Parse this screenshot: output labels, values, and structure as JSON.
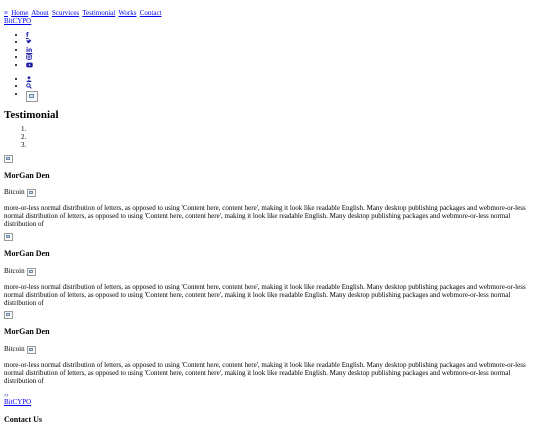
{
  "header": {
    "toggle": "≡",
    "nav": [
      "Home",
      "About",
      "Scurvices",
      "Testimonial",
      "Works",
      "Contact"
    ],
    "brand": "BitCYPO"
  },
  "social": [
    "facebook-icon",
    "twitter-icon",
    "linkedin-icon",
    "instagram-icon",
    "youtube-icon"
  ],
  "user_tools": [
    "user-icon",
    "search-icon",
    "flag-image"
  ],
  "testimonial": {
    "title": "Testimonial",
    "indicators": [
      "",
      "",
      ""
    ],
    "items": [
      {
        "name": "MorGan Den",
        "role": "Bitcoin",
        "text": "more-or-less normal distribution of letters, as opposed to using 'Content here, content here', making it look like readable English. Many desktop publishing packages and webmore-or-less normal distribution of letters, as opposed to using 'Content here, content here', making it look like readable English. Many desktop publishing packages and webmore-or-less normal distribution of"
      },
      {
        "name": "MorGan Den",
        "role": "Bitcoin",
        "text": "more-or-less normal distribution of letters, as opposed to using 'Content here, content here', making it look like readable English. Many desktop publishing packages and webmore-or-less normal distribution of letters, as opposed to using 'Content here, content here', making it look like readable English. Many desktop publishing packages and webmore-or-less normal distribution of"
      },
      {
        "name": "MorGan Den",
        "role": "Bitcoin",
        "text": "more-or-less normal distribution of letters, as opposed to using 'Content here, content here', making it look like readable English. Many desktop publishing packages and webmore-or-less normal distribution of letters, as opposed to using 'Content here, content here', making it look like readable English. Many desktop publishing packages and webmore-or-less normal distribution of"
      }
    ],
    "prev": "‹",
    "next": "›"
  },
  "footer": {
    "brand": "BitCYPO",
    "contact_title": "Contact Us"
  }
}
